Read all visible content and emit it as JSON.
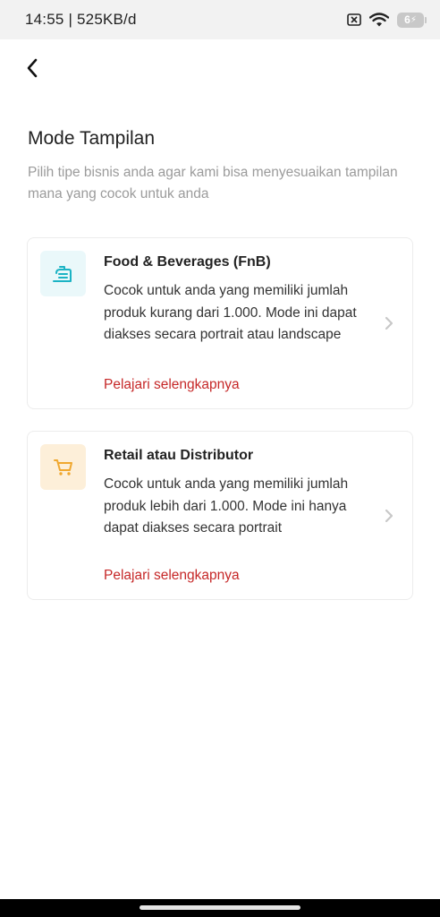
{
  "status_bar": {
    "time_speed": "14:55 | 525KB/d",
    "battery_level": "6"
  },
  "header": {
    "title": "Mode Tampilan",
    "subtitle": "Pilih tipe bisnis anda agar kami bisa menyesuaikan tampilan mana yang cocok untuk anda"
  },
  "modes": [
    {
      "title": "Food & Beverages (FnB)",
      "description": "Cocok untuk anda yang memiliki jumlah produk kurang dari 1.000. Mode ini dapat diakses secara portrait atau landscape",
      "link": "Pelajari selengkapnya",
      "icon": "food-tray-icon",
      "accent": "#1bb3c4",
      "icon_bg": "#eaf8fa"
    },
    {
      "title": "Retail atau Distributor",
      "description": "Cocok untuk anda yang memiliki jumlah produk lebih dari 1.000. Mode ini hanya dapat diakses secara portrait",
      "link": "Pelajari selengkapnya",
      "icon": "shopping-cart-icon",
      "accent": "#f0a830",
      "icon_bg": "#fdefd9"
    }
  ],
  "colors": {
    "link": "#c62828",
    "title": "#222222",
    "subtitle": "#9b9b9b"
  }
}
